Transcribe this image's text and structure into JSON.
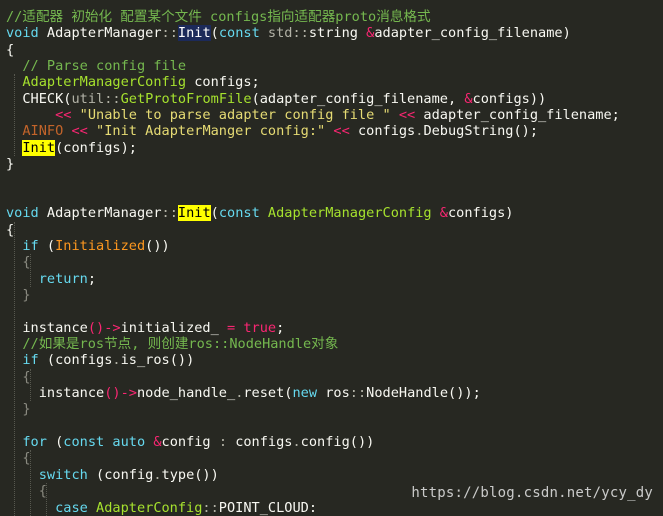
{
  "editor": {
    "background": "#272822",
    "lines": [
      [
        [
          "//适配器 初始化 配置某个文件 configs指向适配器proto消息格式",
          "comment"
        ]
      ],
      [
        [
          "void",
          "kw"
        ],
        [
          " AdapterManager",
          "plain"
        ],
        [
          "::",
          "ns"
        ],
        [
          "Init",
          "hldef"
        ],
        [
          "(",
          "plain"
        ],
        [
          "const",
          "kw"
        ],
        [
          " std",
          "ns"
        ],
        [
          "::",
          "ns"
        ],
        [
          "string ",
          "plain"
        ],
        [
          "&",
          "op"
        ],
        [
          "adapter_config_filename)",
          "plain"
        ]
      ],
      [
        [
          "{",
          "plain"
        ]
      ],
      [
        [
          "  // Parse config file",
          "comment"
        ]
      ],
      [
        [
          "  AdapterManagerConfig",
          "type"
        ],
        [
          " configs;",
          "plain"
        ]
      ],
      [
        [
          "  CHECK(",
          "plain"
        ],
        [
          "util",
          "ns"
        ],
        [
          "::",
          "ns"
        ],
        [
          "GetProtoFromFile",
          "fn"
        ],
        [
          "(adapter_config_filename, ",
          "plain"
        ],
        [
          "&",
          "op"
        ],
        [
          "configs))",
          "plain"
        ]
      ],
      [
        [
          "      << ",
          "op"
        ],
        [
          "\"Unable to parse adapter config file \"",
          "str2"
        ],
        [
          " << ",
          "op"
        ],
        [
          "adapter_config_filename;",
          "plain"
        ]
      ],
      [
        [
          "  AINFO",
          "amacro"
        ],
        [
          " << ",
          "op"
        ],
        [
          "\"Init AdapterManger config:\"",
          "str2"
        ],
        [
          " << ",
          "op"
        ],
        [
          "configs",
          "plain"
        ],
        [
          ".",
          "ns"
        ],
        [
          "DebugString",
          "plain"
        ],
        [
          "();",
          "plain"
        ]
      ],
      [
        [
          "  ",
          "plain"
        ],
        [
          "Init",
          "hlfn"
        ],
        [
          "(configs);",
          "plain"
        ]
      ],
      [
        [
          "}",
          "plain"
        ]
      ],
      [
        [
          "",
          "plain"
        ]
      ],
      [
        [
          "",
          "plain"
        ]
      ],
      [
        [
          "void",
          "kw"
        ],
        [
          " AdapterManager",
          "plain"
        ],
        [
          "::",
          "ns"
        ],
        [
          "Init",
          "hlfn"
        ],
        [
          "(",
          "plain"
        ],
        [
          "const",
          "kw"
        ],
        [
          " AdapterManagerConfig",
          "type"
        ],
        [
          " &",
          "op"
        ],
        [
          "configs)",
          "plain"
        ]
      ],
      [
        [
          "{",
          "plain"
        ]
      ],
      [
        [
          "  if",
          "kw2"
        ],
        [
          " (",
          "plain"
        ],
        [
          "Initialized",
          "var"
        ],
        [
          "())",
          "plain"
        ]
      ],
      [
        [
          "  {",
          "dim"
        ]
      ],
      [
        [
          "    return",
          "kw"
        ],
        [
          ";",
          "plain"
        ]
      ],
      [
        [
          "  }",
          "dim"
        ]
      ],
      [
        [
          "",
          "plain"
        ]
      ],
      [
        [
          "  instance",
          "plain"
        ],
        [
          "()->",
          "op"
        ],
        [
          "initialized_ ",
          "plain"
        ],
        [
          "= ",
          "op"
        ],
        [
          "true",
          "kw3"
        ],
        [
          ";",
          "plain"
        ]
      ],
      [
        [
          "  //如果是ros节点, 则创建ros::NodeHandle对象",
          "comment"
        ]
      ],
      [
        [
          "  if",
          "kw2"
        ],
        [
          " (configs",
          "plain"
        ],
        [
          ".",
          "ns"
        ],
        [
          "is_ros())",
          "plain"
        ]
      ],
      [
        [
          "  {",
          "dim"
        ]
      ],
      [
        [
          "    instance",
          "plain"
        ],
        [
          "()->",
          "op"
        ],
        [
          "node_handle_",
          "plain"
        ],
        [
          ".",
          "ns"
        ],
        [
          "reset(",
          "plain"
        ],
        [
          "new",
          "kw"
        ],
        [
          " ros",
          "plain"
        ],
        [
          "::",
          "ns"
        ],
        [
          "NodeHandle());",
          "plain"
        ]
      ],
      [
        [
          "  }",
          "dim"
        ]
      ],
      [
        [
          "",
          "plain"
        ]
      ],
      [
        [
          "  for",
          "kw2"
        ],
        [
          " (",
          "plain"
        ],
        [
          "const",
          "kw"
        ],
        [
          " auto",
          "kw"
        ],
        [
          " &",
          "op"
        ],
        [
          "config ",
          "plain"
        ],
        [
          ": ",
          "ns"
        ],
        [
          "configs",
          "plain"
        ],
        [
          ".",
          "ns"
        ],
        [
          "config())",
          "plain"
        ]
      ],
      [
        [
          "  {",
          "dim"
        ]
      ],
      [
        [
          "    switch",
          "kw2"
        ],
        [
          " (config",
          "plain"
        ],
        [
          ".",
          "ns"
        ],
        [
          "type())",
          "plain"
        ]
      ],
      [
        [
          "    {",
          "dim"
        ]
      ],
      [
        [
          "      case",
          "kw2"
        ],
        [
          " AdapterConfig",
          "type"
        ],
        [
          "::",
          "ns"
        ],
        [
          "POINT_CLOUD:",
          "plain"
        ]
      ]
    ]
  },
  "watermark": "https://blog.csdn.net/ycy_dy"
}
